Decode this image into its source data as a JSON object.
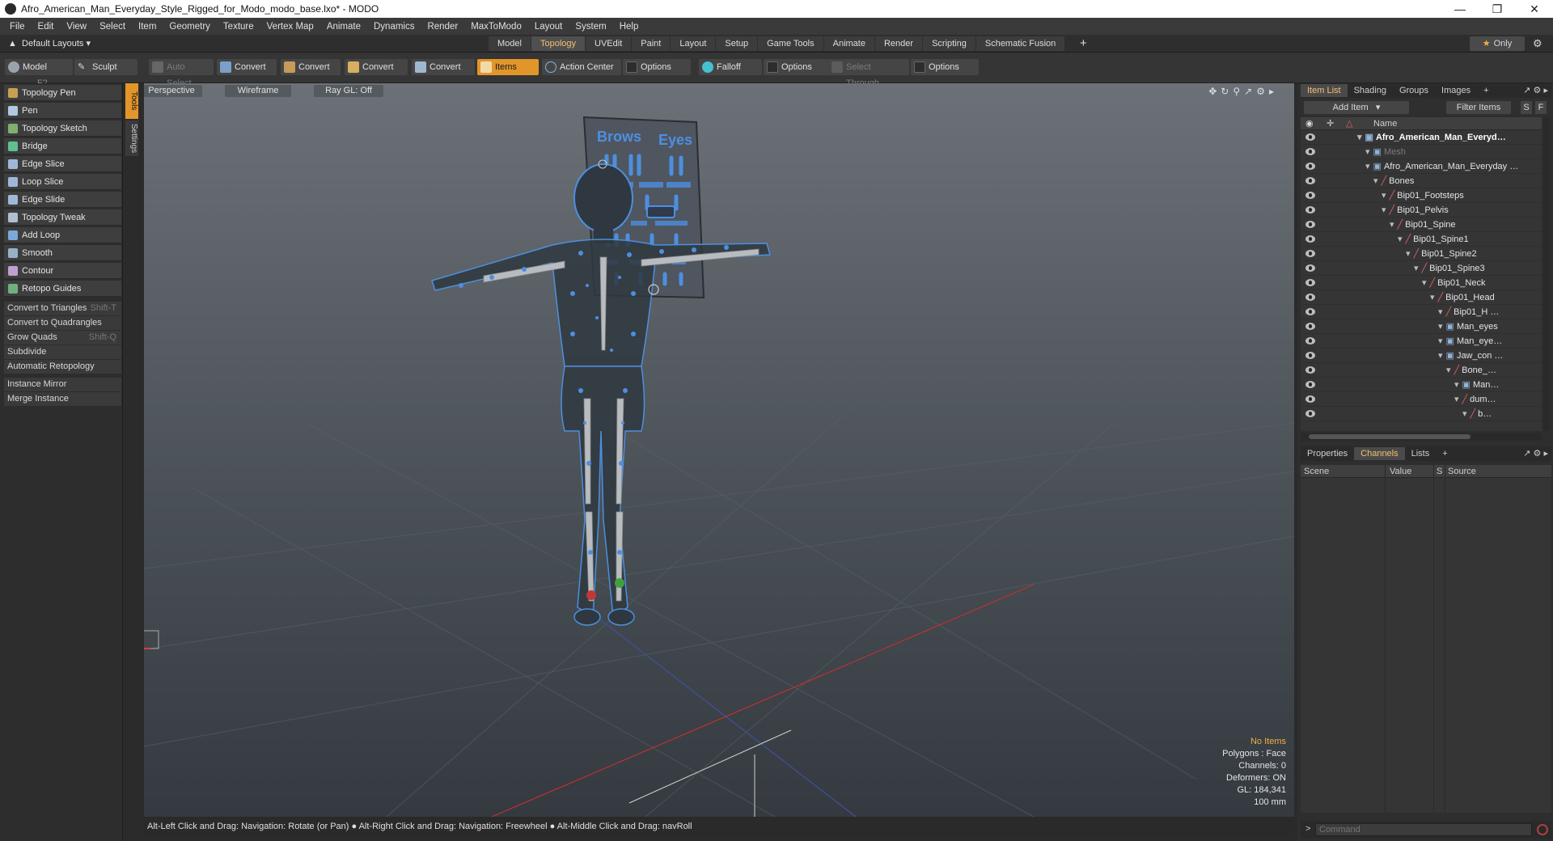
{
  "window": {
    "title": "Afro_American_Man_Everyday_Style_Rigged_for_Modo_modo_base.lxo* - MODO"
  },
  "menu": [
    "File",
    "Edit",
    "View",
    "Select",
    "Item",
    "Geometry",
    "Texture",
    "Vertex Map",
    "Animate",
    "Dynamics",
    "Render",
    "MaxToModo",
    "Layout",
    "System",
    "Help"
  ],
  "layout_bar": {
    "default_layouts": "Default Layouts",
    "tabs": [
      "Model",
      "Topology",
      "UVEdit",
      "Paint",
      "Layout",
      "Setup",
      "Game Tools",
      "Animate",
      "Render",
      "Scripting",
      "Schematic Fusion"
    ],
    "active_tab": "Topology",
    "only_label": "Only"
  },
  "toolbar": {
    "model": "Model",
    "model_key": "F2",
    "sculpt": "Sculpt",
    "auto_select": "Auto Select",
    "convert": "Convert",
    "items": "Items",
    "action_center": "Action Center",
    "options": "Options",
    "falloff": "Falloff",
    "select_through": "Select Through"
  },
  "tools": [
    "Topology Pen",
    "Pen",
    "Topology Sketch",
    "Bridge",
    "Edge Slice",
    "Loop Slice",
    "Edge Slide",
    "Topology Tweak",
    "Add Loop",
    "Smooth",
    "Contour",
    "Retopo Guides"
  ],
  "commands": [
    {
      "label": "Convert to Triangles",
      "shortcut": "Shift-T"
    },
    {
      "label": "Convert to Quadrangles",
      "shortcut": ""
    },
    {
      "label": "Grow Quads",
      "shortcut": "Shift-Q"
    },
    {
      "label": "Subdivide",
      "shortcut": ""
    },
    {
      "label": "Automatic Retopology",
      "shortcut": ""
    },
    {
      "label": "Instance Mirror",
      "shortcut": ""
    },
    {
      "label": "Merge Instance",
      "shortcut": ""
    }
  ],
  "side_tabs": [
    "Tools",
    "Settings"
  ],
  "viewport": {
    "view": "Perspective",
    "shading": "Wireframe",
    "raygl": "Ray GL: Off",
    "rig_labels": {
      "brows": "Brows",
      "eyes": "Eyes"
    },
    "info": [
      "No Items",
      "Polygons : Face",
      "Channels: 0",
      "Deformers: ON",
      "GL: 184,341",
      "100 mm"
    ]
  },
  "status": "Alt-Left Click and Drag: Navigation: Rotate (or Pan) ● Alt-Right Click and Drag: Navigation: Freewheel ● Alt-Middle Click and Drag: navRoll",
  "right_panel": {
    "tabs_top": [
      "Item List",
      "Shading",
      "Groups",
      "Images"
    ],
    "add_item": "Add Item",
    "filter_items": "Filter Items",
    "s_label": "S",
    "f_label": "F",
    "name_header": "Name",
    "items": [
      {
        "label": "Afro_American_Man_Everyd…",
        "depth": 0,
        "type": "scene",
        "bold": true
      },
      {
        "label": "Mesh",
        "depth": 1,
        "type": "mesh",
        "dim": true
      },
      {
        "label": "Afro_American_Man_Everyday …",
        "depth": 1,
        "type": "group"
      },
      {
        "label": "Bones",
        "depth": 2,
        "type": "bone"
      },
      {
        "label": "Bip01_Footsteps",
        "depth": 3,
        "type": "bone"
      },
      {
        "label": "Bip01_Pelvis",
        "depth": 3,
        "type": "bone"
      },
      {
        "label": "Bip01_Spine",
        "depth": 4,
        "type": "bone"
      },
      {
        "label": "Bip01_Spine1",
        "depth": 5,
        "type": "bone"
      },
      {
        "label": "Bip01_Spine2",
        "depth": 6,
        "type": "bone"
      },
      {
        "label": "Bip01_Spine3",
        "depth": 7,
        "type": "bone"
      },
      {
        "label": "Bip01_Neck",
        "depth": 8,
        "type": "bone"
      },
      {
        "label": "Bip01_Head",
        "depth": 9,
        "type": "bone"
      },
      {
        "label": "Bip01_H …",
        "depth": 10,
        "type": "bone"
      },
      {
        "label": "Man_eyes",
        "depth": 10,
        "type": "mesh"
      },
      {
        "label": "Man_eye…",
        "depth": 10,
        "type": "mesh"
      },
      {
        "label": "Jaw_con …",
        "depth": 10,
        "type": "mesh"
      },
      {
        "label": "Bone_…",
        "depth": 11,
        "type": "bone"
      },
      {
        "label": "Man…",
        "depth": 12,
        "type": "mesh"
      },
      {
        "label": "dum…",
        "depth": 12,
        "type": "bone"
      },
      {
        "label": "b…",
        "depth": 13,
        "type": "bone"
      }
    ],
    "tabs_bottom": [
      "Properties",
      "Channels",
      "Lists"
    ],
    "channel_headers": [
      "Scene",
      "Value",
      "S",
      "Source"
    ],
    "command_placeholder": "Command"
  },
  "colors": {
    "accent": "#e2962a",
    "active_text": "#f4c070",
    "wire": "#4d8fe0"
  }
}
